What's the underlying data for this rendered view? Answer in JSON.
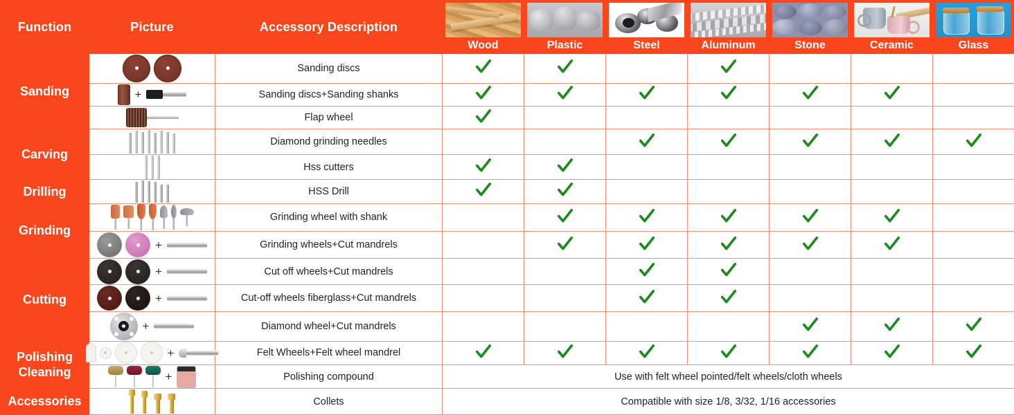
{
  "table": {
    "headers": {
      "function": "Function",
      "picture": "Picture",
      "description": "Accessory Description"
    },
    "materials": [
      {
        "label": "Wood",
        "image": "wood-planks-photo"
      },
      {
        "label": "Plastic",
        "image": "plastic-pipes-photo"
      },
      {
        "label": "Steel",
        "image": "steel-tubes-photo"
      },
      {
        "label": "Aluminum",
        "image": "aluminum-extrusions-photo"
      },
      {
        "label": "Stone",
        "image": "stone-pebbles-photo"
      },
      {
        "label": "Ceramic",
        "image": "ceramic-mugs-photo"
      },
      {
        "label": "Glass",
        "image": "glass-jars-photo"
      }
    ],
    "functions": [
      {
        "label": "Sanding",
        "rows": 3
      },
      {
        "label": "Carving",
        "rows": 2
      },
      {
        "label": "Drilling",
        "rows": 1
      },
      {
        "label": "Grinding",
        "rows": 2
      },
      {
        "label": "Cutting",
        "rows": 3
      },
      {
        "label": "Polishing\nCleaning",
        "rows": 2
      },
      {
        "label": "Accessories",
        "rows": 1
      }
    ],
    "rows": [
      {
        "description": "Sanding discs",
        "picture": "two-brown-sanding-discs",
        "checks": [
          true,
          true,
          false,
          true,
          false,
          false,
          false
        ]
      },
      {
        "description": "Sanding discs+Sanding shanks",
        "picture": "sanding-drum-plus-shank",
        "checks": [
          true,
          true,
          true,
          true,
          true,
          true,
          false
        ]
      },
      {
        "description": "Flap wheel",
        "picture": "flap-wheel-on-shank",
        "checks": [
          true,
          false,
          false,
          false,
          false,
          false,
          false
        ]
      },
      {
        "description": "Diamond grinding needles",
        "picture": "diamond-needle-bit-set",
        "checks": [
          false,
          false,
          true,
          true,
          true,
          true,
          true
        ]
      },
      {
        "description": "Hss cutters",
        "picture": "hss-cutter-set",
        "checks": [
          true,
          true,
          false,
          false,
          false,
          false,
          false
        ]
      },
      {
        "description": "HSS Drill",
        "picture": "hss-drill-bit-set",
        "checks": [
          true,
          true,
          false,
          false,
          false,
          false,
          false
        ]
      },
      {
        "description": "Grinding wheel with shank",
        "picture": "mounted-grinding-stone-set",
        "checks": [
          false,
          true,
          true,
          true,
          true,
          true,
          false
        ]
      },
      {
        "description": "Grinding wheels+Cut mandrels",
        "picture": "grey-pink-grinding-wheels-plus-mandrel",
        "checks": [
          false,
          true,
          true,
          true,
          true,
          true,
          false
        ]
      },
      {
        "description": "Cut off wheels+Cut mandrels",
        "picture": "black-cutoff-wheels-plus-mandrel",
        "checks": [
          false,
          false,
          true,
          true,
          false,
          false,
          false
        ]
      },
      {
        "description": "Cut-off wheels fiberglass+Cut mandrels",
        "picture": "fiberglass-cutoff-wheels-plus-mandrel",
        "checks": [
          false,
          false,
          true,
          true,
          false,
          false,
          false
        ]
      },
      {
        "description": "Diamond wheel+Cut mandrels",
        "picture": "diamond-wheel-plus-mandrel",
        "checks": [
          false,
          false,
          false,
          false,
          true,
          true,
          true
        ]
      },
      {
        "description": "Felt Wheels+Felt wheel mandrel",
        "picture": "felt-wheels-plus-felt-mandrel",
        "checks": [
          true,
          true,
          true,
          true,
          true,
          true,
          true
        ]
      },
      {
        "description": "Polishing compound",
        "picture": "polishing-mops-plus-compound-jar",
        "note": "Use with felt wheel pointed/felt wheels/cloth wheels"
      },
      {
        "description": "Collets",
        "picture": "brass-collet-set",
        "note": "Compatible with size 1/8, 3/32, 1/16 accessories"
      }
    ]
  },
  "colors": {
    "brand_orange": "#F9461C",
    "border": "#F98E74",
    "check_green": "#1E8A1E",
    "text": "#222222"
  }
}
